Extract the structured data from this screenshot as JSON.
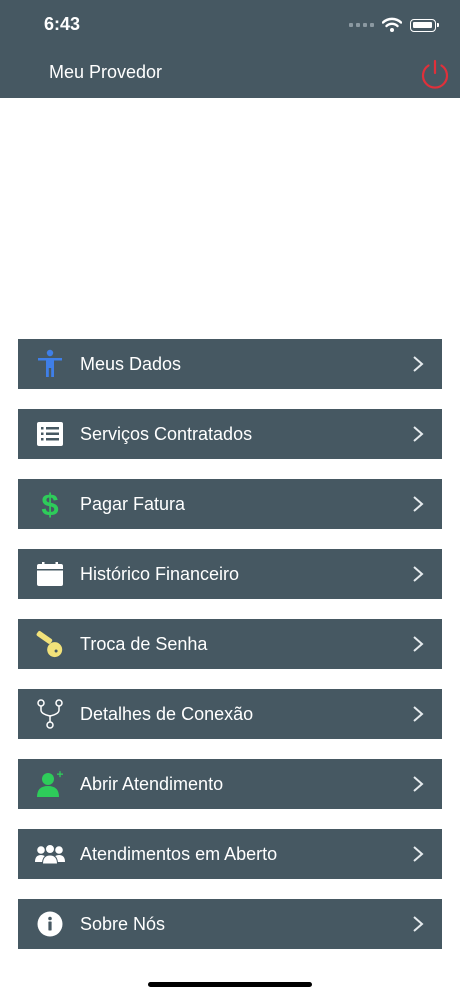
{
  "status_bar": {
    "time": "6:43"
  },
  "header": {
    "title": "Meu Provedor"
  },
  "menu": {
    "items": [
      {
        "label": "Meus Dados",
        "icon": "person-icon"
      },
      {
        "label": "Serviços Contratados",
        "icon": "list-icon"
      },
      {
        "label": "Pagar Fatura",
        "icon": "dollar-icon"
      },
      {
        "label": "Histórico Financeiro",
        "icon": "calendar-icon"
      },
      {
        "label": "Troca de Senha",
        "icon": "key-icon"
      },
      {
        "label": "Detalhes de Conexão",
        "icon": "network-icon"
      },
      {
        "label": "Abrir Atendimento",
        "icon": "add-user-icon"
      },
      {
        "label": "Atendimentos em Aberto",
        "icon": "group-icon"
      },
      {
        "label": "Sobre Nós",
        "icon": "info-icon"
      }
    ]
  },
  "colors": {
    "bar": "#465862",
    "power": "#e0303a",
    "person": "#3f7fe8",
    "dollar": "#2ecc5a",
    "key": "#f2e27a",
    "add_user": "#2ecc5a"
  }
}
